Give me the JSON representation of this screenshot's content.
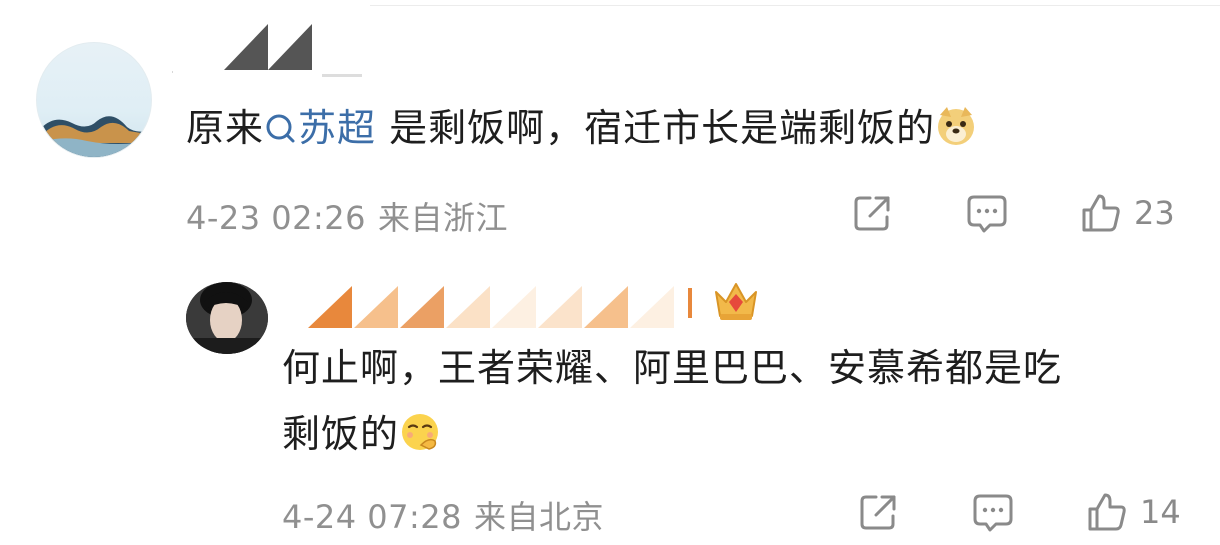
{
  "comments": [
    {
      "text_before": "原来",
      "topic": "苏超",
      "text_after": " 是剩饭啊，宿迁市长是端剩饭的",
      "emoji": "doge-emoji",
      "time": "4-23 02:26",
      "location": "来自浙江",
      "likes": "23"
    },
    {
      "text_line1": "何止啊，王者荣耀、阿里巴巴、安慕希都是吃",
      "text_line2": "剩饭的",
      "emoji": "smirk-hand-emoji",
      "time": "4-24 07:28",
      "location": "来自北京",
      "likes": "14"
    }
  ],
  "icons": {
    "share": "share-icon",
    "comment": "comment-icon",
    "like": "thumbs-up-icon",
    "topic": "search-icon",
    "badge": "crown-icon"
  },
  "colors": {
    "topic_link": "#3c6ea8",
    "meta_text": "#909090",
    "masked_name_orange": "#e8883c"
  }
}
